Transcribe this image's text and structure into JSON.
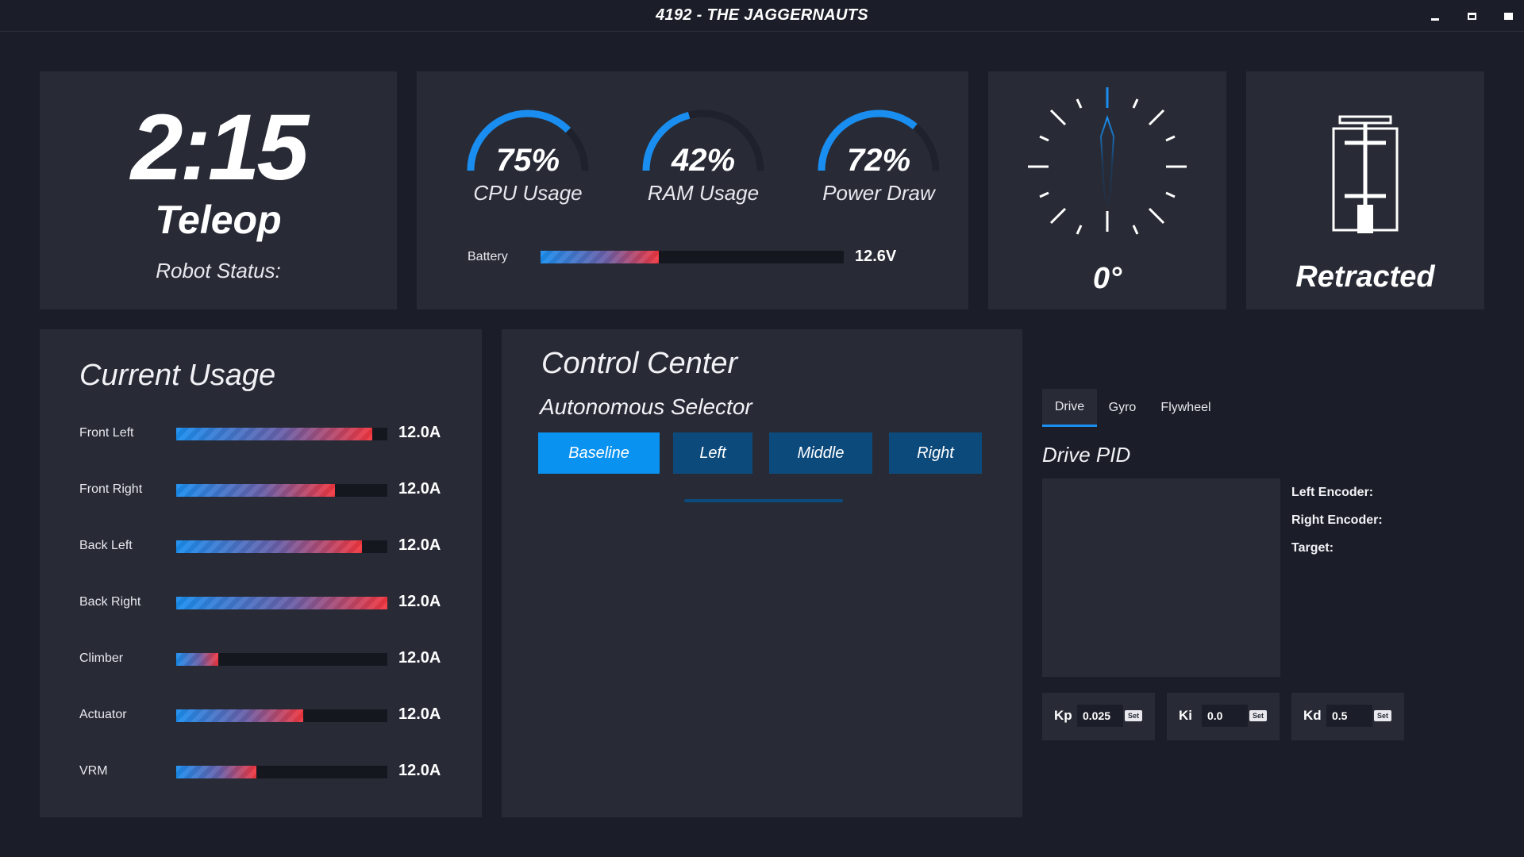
{
  "window": {
    "title": "4192 - THE JAGGERNAUTS"
  },
  "match": {
    "time": "2:15",
    "mode": "Teleop",
    "robot_status_label": "Robot Status:"
  },
  "system": {
    "gauges": [
      {
        "value": "75%",
        "label": "CPU Usage",
        "fraction": 0.75
      },
      {
        "value": "42%",
        "label": "RAM Usage",
        "fraction": 0.42
      },
      {
        "value": "72%",
        "label": "Power Draw",
        "fraction": 0.72
      }
    ],
    "battery": {
      "label": "Battery",
      "value": "12.6V",
      "fraction": 0.39
    }
  },
  "gyro": {
    "value": "0°",
    "angle_deg": 0
  },
  "actuator": {
    "state": "Retracted"
  },
  "current_usage": {
    "title": "Current Usage",
    "rows": [
      {
        "label": "Front Left",
        "value": "12.0A",
        "fraction": 0.93
      },
      {
        "label": "Front Right",
        "value": "12.0A",
        "fraction": 0.75
      },
      {
        "label": "Back Left",
        "value": "12.0A",
        "fraction": 0.88
      },
      {
        "label": "Back Right",
        "value": "12.0A",
        "fraction": 1.0
      },
      {
        "label": "Climber",
        "value": "12.0A",
        "fraction": 0.2
      },
      {
        "label": "Actuator",
        "value": "12.0A",
        "fraction": 0.6
      },
      {
        "label": "VRM",
        "value": "12.0A",
        "fraction": 0.38
      }
    ]
  },
  "control_center": {
    "title": "Control Center",
    "selector_title": "Autonomous Selector",
    "options": [
      "Baseline",
      "Left",
      "Middle",
      "Right"
    ],
    "selected": "Baseline"
  },
  "pid": {
    "tabs": [
      "Drive",
      "Gyro",
      "Flywheel"
    ],
    "active_tab": "Drive",
    "title": "Drive PID",
    "encoder_labels": [
      "Left Encoder:",
      "Right Encoder:",
      "Target:"
    ],
    "gains": [
      {
        "name": "Kp",
        "value": "0.025",
        "set_label": "Set"
      },
      {
        "name": "Ki",
        "value": "0.0",
        "set_label": "Set"
      },
      {
        "name": "Kd",
        "value": "0.5",
        "set_label": "Set"
      }
    ]
  },
  "colors": {
    "background": "#1b1e28",
    "panel": "#282b36",
    "accent_blue": "#0a92f0",
    "bar_red": "#f2363f",
    "button_blue": "#0c4a7c"
  }
}
